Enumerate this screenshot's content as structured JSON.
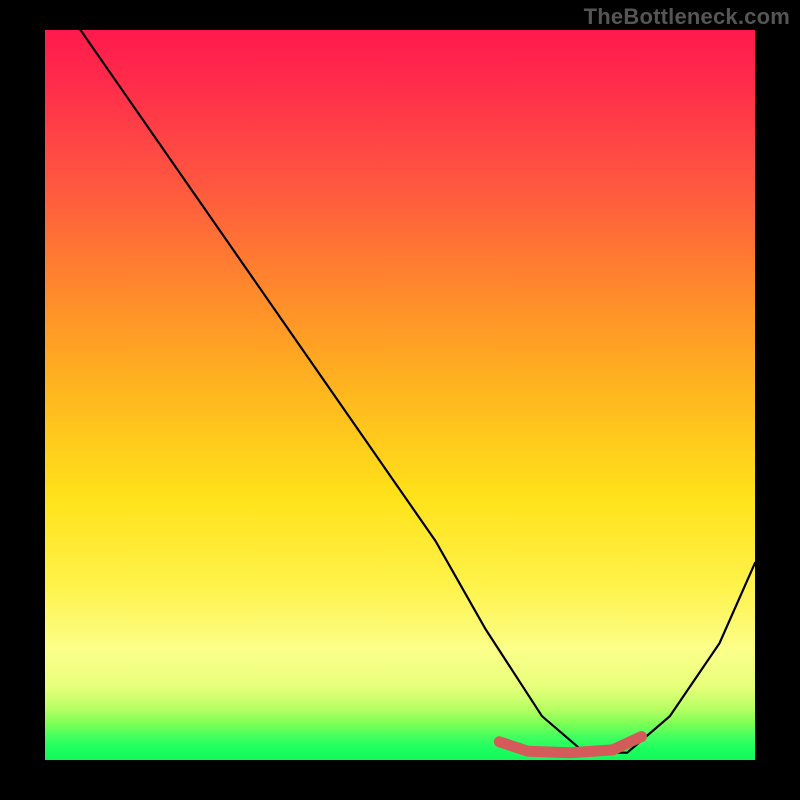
{
  "watermark": "TheBottleneck.com",
  "chart_data": {
    "type": "line",
    "title": "",
    "xlabel": "",
    "ylabel": "",
    "xlim": [
      0,
      100
    ],
    "ylim": [
      0,
      100
    ],
    "series": [
      {
        "name": "curve",
        "x": [
          5,
          15,
          25,
          35,
          45,
          55,
          62,
          70,
          76,
          82,
          88,
          95,
          100
        ],
        "y": [
          100,
          86,
          72,
          58,
          44,
          30,
          18,
          6,
          1,
          1,
          6,
          16,
          27
        ]
      }
    ],
    "highlight_segment": {
      "x": [
        64,
        68,
        74,
        80,
        84
      ],
      "y": [
        2.5,
        1.2,
        1,
        1.4,
        3.2
      ]
    },
    "gradient_stops_top_to_bottom": [
      {
        "pos": 0,
        "color": "#ff1a4d"
      },
      {
        "pos": 22,
        "color": "#ff5a3f"
      },
      {
        "pos": 50,
        "color": "#ffb81e"
      },
      {
        "pos": 76,
        "color": "#fff24a"
      },
      {
        "pos": 93,
        "color": "#b6ff63"
      },
      {
        "pos": 100,
        "color": "#13f85a"
      }
    ]
  }
}
